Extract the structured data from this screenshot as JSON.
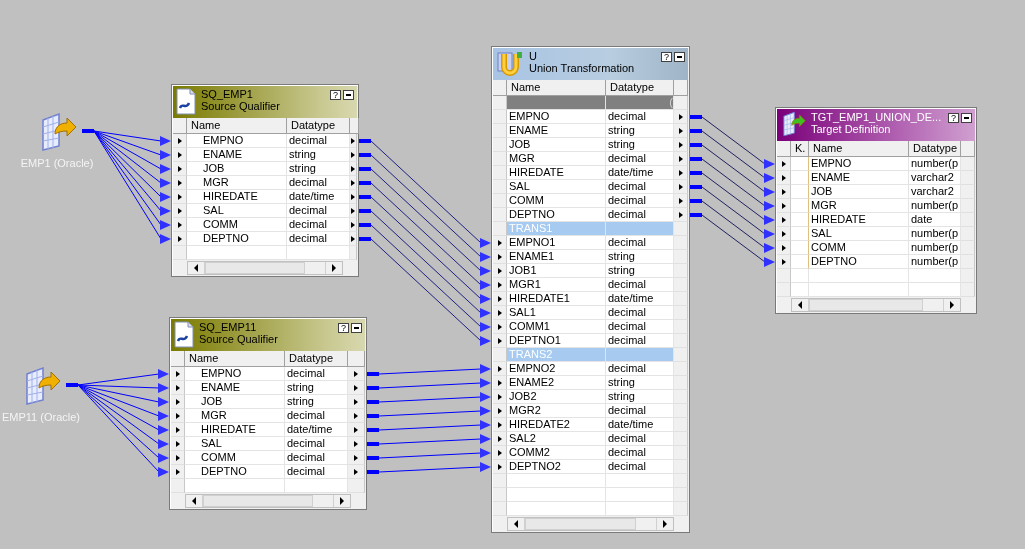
{
  "sources": [
    {
      "label": "EMP1 (Oracle)"
    },
    {
      "label": "EMP11 (Oracle)"
    }
  ],
  "qualifiers": [
    {
      "kind": "source_qualifier",
      "name": "SQ_EMP1",
      "type": "Source Qualifier",
      "help": "?",
      "columns": [
        "Name",
        "Datatype"
      ],
      "ports": [
        {
          "name": "EMPNO",
          "datatype": "decimal"
        },
        {
          "name": "ENAME",
          "datatype": "string"
        },
        {
          "name": "JOB",
          "datatype": "string"
        },
        {
          "name": "MGR",
          "datatype": "decimal"
        },
        {
          "name": "HIREDATE",
          "datatype": "date/time"
        },
        {
          "name": "SAL",
          "datatype": "decimal"
        },
        {
          "name": "COMM",
          "datatype": "decimal"
        },
        {
          "name": "DEPTNO",
          "datatype": "decimal"
        }
      ]
    },
    {
      "kind": "source_qualifier",
      "name": "SQ_EMP11",
      "type": "Source Qualifier",
      "help": "?",
      "columns": [
        "Name",
        "Datatype"
      ],
      "ports": [
        {
          "name": "EMPNO",
          "datatype": "decimal"
        },
        {
          "name": "ENAME",
          "datatype": "string"
        },
        {
          "name": "JOB",
          "datatype": "string"
        },
        {
          "name": "MGR",
          "datatype": "decimal"
        },
        {
          "name": "HIREDATE",
          "datatype": "date/time"
        },
        {
          "name": "SAL",
          "datatype": "decimal"
        },
        {
          "name": "COMM",
          "datatype": "decimal"
        },
        {
          "name": "DEPTNO",
          "datatype": "decimal"
        }
      ]
    }
  ],
  "union": {
    "kind": "union",
    "name": "U",
    "type": "Union Transformation",
    "help": "?",
    "columns": [
      "Name",
      "Datatype"
    ],
    "header_row": "(",
    "output_ports": [
      {
        "name": "EMPNO",
        "datatype": "decimal"
      },
      {
        "name": "ENAME",
        "datatype": "string"
      },
      {
        "name": "JOB",
        "datatype": "string"
      },
      {
        "name": "MGR",
        "datatype": "decimal"
      },
      {
        "name": "HIREDATE",
        "datatype": "date/time"
      },
      {
        "name": "SAL",
        "datatype": "decimal"
      },
      {
        "name": "COMM",
        "datatype": "decimal"
      },
      {
        "name": "DEPTNO",
        "datatype": "decimal"
      }
    ],
    "groups": [
      {
        "name": "TRANS1",
        "ports": [
          {
            "name": "EMPNO1",
            "datatype": "decimal"
          },
          {
            "name": "ENAME1",
            "datatype": "string"
          },
          {
            "name": "JOB1",
            "datatype": "string"
          },
          {
            "name": "MGR1",
            "datatype": "decimal"
          },
          {
            "name": "HIREDATE1",
            "datatype": "date/time"
          },
          {
            "name": "SAL1",
            "datatype": "decimal"
          },
          {
            "name": "COMM1",
            "datatype": "decimal"
          },
          {
            "name": "DEPTNO1",
            "datatype": "decimal"
          }
        ]
      },
      {
        "name": "TRANS2",
        "ports": [
          {
            "name": "EMPNO2",
            "datatype": "decimal"
          },
          {
            "name": "ENAME2",
            "datatype": "string"
          },
          {
            "name": "JOB2",
            "datatype": "string"
          },
          {
            "name": "MGR2",
            "datatype": "decimal"
          },
          {
            "name": "HIREDATE2",
            "datatype": "date/time"
          },
          {
            "name": "SAL2",
            "datatype": "decimal"
          },
          {
            "name": "COMM2",
            "datatype": "decimal"
          },
          {
            "name": "DEPTNO2",
            "datatype": "decimal"
          }
        ]
      }
    ]
  },
  "target": {
    "kind": "target",
    "name": "TGT_EMP1_UNION_DE...",
    "type": "Target Definition",
    "help": "?",
    "columns": [
      "K.",
      "Name",
      "Datatype"
    ],
    "ports": [
      {
        "name": "EMPNO",
        "datatype": "number(p"
      },
      {
        "name": "ENAME",
        "datatype": "varchar2"
      },
      {
        "name": "JOB",
        "datatype": "varchar2"
      },
      {
        "name": "MGR",
        "datatype": "number(p"
      },
      {
        "name": "HIREDATE",
        "datatype": "date"
      },
      {
        "name": "SAL",
        "datatype": "number(p"
      },
      {
        "name": "COMM",
        "datatype": "number(p"
      },
      {
        "name": "DEPTNO",
        "datatype": "number(p"
      }
    ]
  }
}
